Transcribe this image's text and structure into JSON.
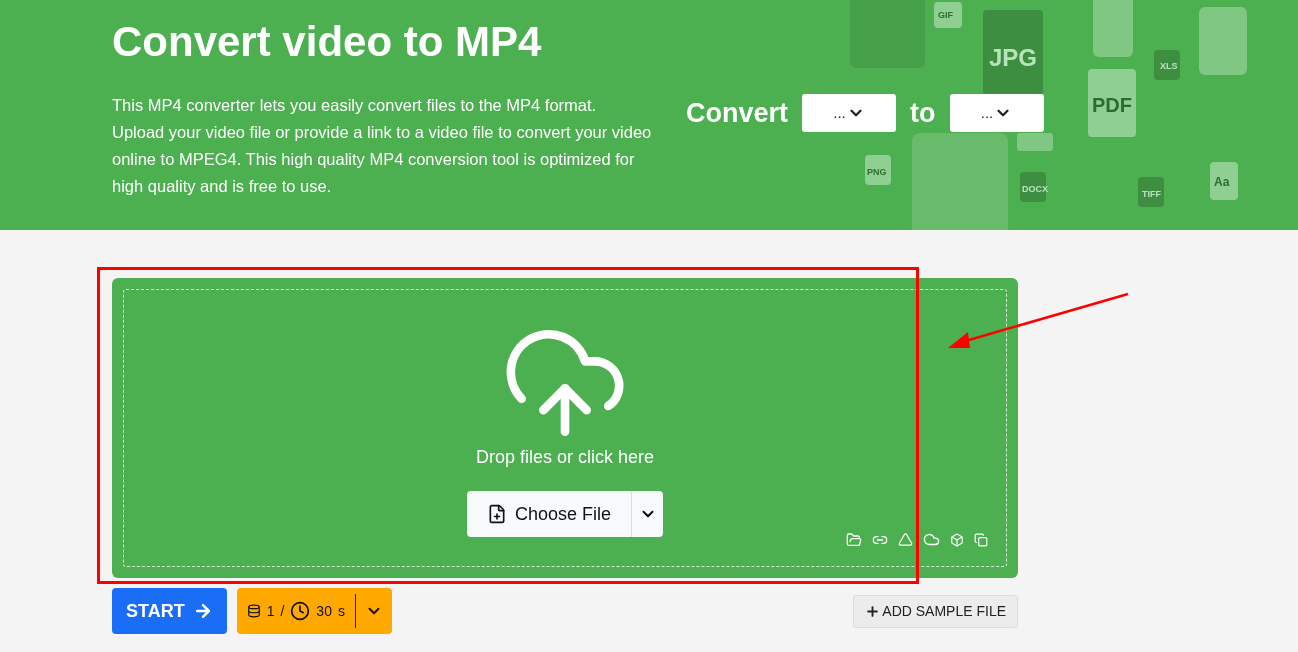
{
  "header": {
    "title": "Convert video to MP4",
    "description": "This MP4 converter lets you easily convert files to the MP4 format. Upload your video file or provide a link to a video file to convert your video online to MPEG4. This high quality MP4 conversion tool is optimized for high quality and is free to use.",
    "convert_label": "Convert",
    "from_select": {
      "value": "..."
    },
    "to_label": "to",
    "to_select": {
      "value": "..."
    },
    "background_file_labels": [
      "GIF",
      "JPG",
      "XLS",
      "PDF",
      "PNG",
      "DOCX",
      "TIFF",
      "Aa"
    ]
  },
  "dropzone": {
    "prompt": "Drop files or click here",
    "choose_button": "Choose File"
  },
  "actions": {
    "start_button": "START",
    "credits": "1",
    "separator": "/",
    "time": "30",
    "time_unit": "s",
    "sample_button": "ADD SAMPLE FILE"
  }
}
